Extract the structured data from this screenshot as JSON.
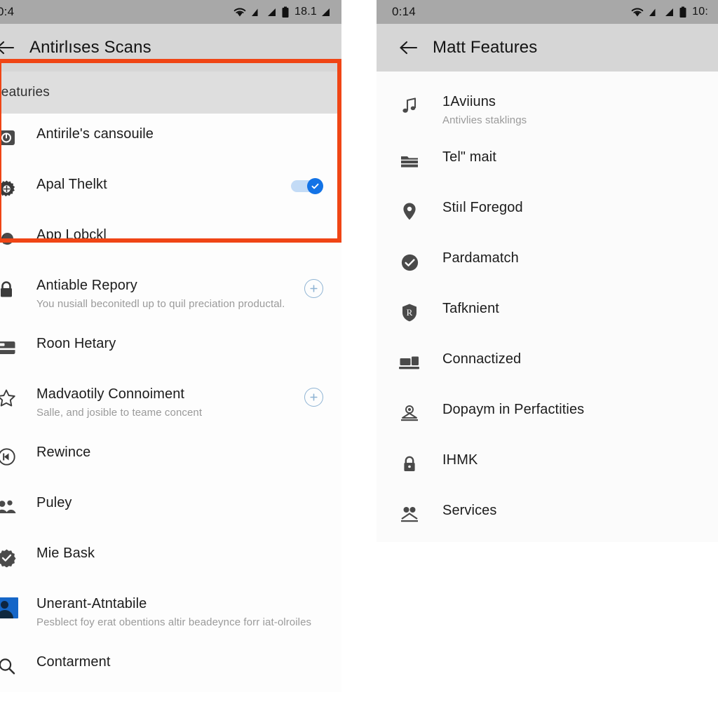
{
  "left_panel": {
    "status": {
      "clock": "0:4",
      "battery_text": "18.1",
      "wifi_icon": "wifi-icon",
      "signal_icon": "signal-icon",
      "battery_icon": "battery-icon"
    },
    "app_bar": {
      "back_icon": "back-arrow-icon",
      "title": "Antirlıses Scans"
    },
    "section_header": "Featuries",
    "rows": [
      {
        "icon": "target-square-icon",
        "title": "Antirile's cansouile",
        "sub": "",
        "trailing": "none"
      },
      {
        "icon": "gear-icon",
        "title": "Apal Thelkt",
        "sub": "",
        "trailing": "toggle-on"
      },
      {
        "icon": "moon-icon",
        "title": "App Lobckl",
        "sub": "",
        "trailing": "none"
      },
      {
        "icon": "lock-icon",
        "title": "Antiable Repory",
        "sub": "You nusiall beconitedl up to quil preciation productal.",
        "trailing": "plus"
      },
      {
        "icon": "card-icon",
        "title": "Roon Hetary",
        "sub": "",
        "trailing": "none"
      },
      {
        "icon": "star-icon",
        "title": "Madvaotily Connoiment",
        "sub": "Salle, and josible to teame concent",
        "trailing": "plus"
      },
      {
        "icon": "rewind-circle-icon",
        "title": "Rewince",
        "sub": "",
        "trailing": "none"
      },
      {
        "icon": "people-icon",
        "title": "Puley",
        "sub": "",
        "trailing": "none"
      },
      {
        "icon": "check-badge-icon",
        "title": "Mie Bask",
        "sub": "",
        "trailing": "none"
      },
      {
        "icon": "avatar-thumbnail",
        "title": "Unerant-Atntabile",
        "sub": "Pesblect foy erat obentions altir beadeynce forr iat-olroiles",
        "trailing": "none"
      },
      {
        "icon": "search-icon",
        "title": "Contarment",
        "sub": "",
        "trailing": "none"
      }
    ]
  },
  "right_panel": {
    "status": {
      "clock": "0:14",
      "battery_text": "10:",
      "wifi_icon": "wifi-icon",
      "signal_icon": "signal-icon",
      "battery_icon": "battery-icon"
    },
    "app_bar": {
      "back_icon": "back-arrow-icon",
      "title": "Matt Features"
    },
    "rows": [
      {
        "icon": "music-note-icon",
        "title": "1Aviiuns",
        "sub": "Antivlies staklings"
      },
      {
        "icon": "folder-icon",
        "title": "Tel\" mait",
        "sub": ""
      },
      {
        "icon": "location-pin-icon",
        "title": "Stiıl Foregod",
        "sub": ""
      },
      {
        "icon": "check-circle-icon",
        "title": "Pardamatch",
        "sub": ""
      },
      {
        "icon": "shield-r-icon",
        "title": "Tafknient",
        "sub": ""
      },
      {
        "icon": "devices-icon",
        "title": "Connactized",
        "sub": ""
      },
      {
        "icon": "person-pin-icon",
        "title": "Dopaym in Perfactities",
        "sub": ""
      },
      {
        "icon": "lock-icon",
        "title": "IHMK",
        "sub": ""
      },
      {
        "icon": "people-outline-icon",
        "title": "Services",
        "sub": ""
      }
    ]
  },
  "annotation": {
    "highlight_color": "#f04515"
  }
}
